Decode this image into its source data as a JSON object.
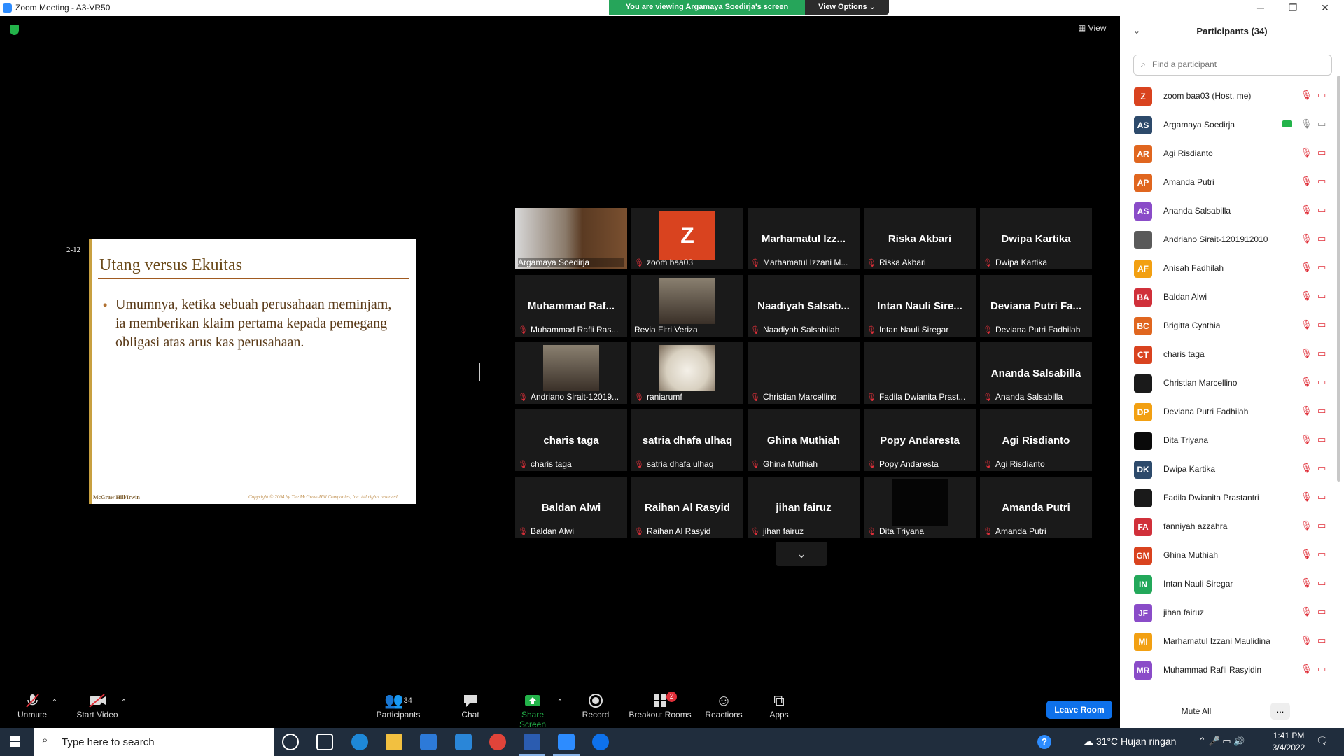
{
  "window": {
    "title": "Zoom Meeting - A3-VR50",
    "minimize": "─",
    "maximize": "❐",
    "close": "✕"
  },
  "banner": {
    "viewing": "You are viewing Argamaya Soedirja's screen",
    "view_options": "View Options ⌄"
  },
  "view_label": "View",
  "slide": {
    "number": "2-12",
    "title": "Utang versus Ekuitas",
    "bullet": "Umumnya, ketika sebuah perusahaan meminjam, ia memberikan klaim pertama kepada pemegang obligasi atas arus kas perusahaan.",
    "footer_left": "McGraw Hill/Irwin",
    "footer_right": "Copyright © 2004 by The McGraw-Hill Companies, Inc.  All rights reserved."
  },
  "tiles": [
    {
      "big": "",
      "name": "Argamaya Soedirja",
      "mic_off": false,
      "kind": "video",
      "active": true
    },
    {
      "big": "",
      "name": "zoom baa03",
      "mic_off": true,
      "kind": "z-avatar"
    },
    {
      "big": "Marhamatul  Izz...",
      "name": "Marhamatul Izzani M...",
      "mic_off": true,
      "kind": "name"
    },
    {
      "big": "Riska Akbari",
      "name": "Riska Akbari",
      "mic_off": true,
      "kind": "name"
    },
    {
      "big": "Dwipa Kartika",
      "name": "Dwipa Kartika",
      "mic_off": true,
      "kind": "name"
    },
    {
      "big": "Muhammad  Raf...",
      "name": "Muhammad Rafli Ras...",
      "mic_off": true,
      "kind": "name"
    },
    {
      "big": "",
      "name": "Revia Fitri Veriza",
      "mic_off": false,
      "kind": "photo"
    },
    {
      "big": "Naadiyah  Salsab...",
      "name": "Naadiyah Salsabilah",
      "mic_off": true,
      "kind": "name"
    },
    {
      "big": "Intan Nauli Sire...",
      "name": "Intan Nauli Siregar",
      "mic_off": true,
      "kind": "name"
    },
    {
      "big": "Deviana Putri Fa...",
      "name": "Deviana Putri Fadhilah",
      "mic_off": true,
      "kind": "name"
    },
    {
      "big": "",
      "name": "Andriano Sirait-12019...",
      "mic_off": true,
      "kind": "photo"
    },
    {
      "big": "",
      "name": "raniarumf",
      "mic_off": true,
      "kind": "cat"
    },
    {
      "big": "",
      "name": "Christian Marcellino",
      "mic_off": true,
      "kind": "blank"
    },
    {
      "big": "",
      "name": "Fadila Dwianita Prast...",
      "mic_off": true,
      "kind": "blank"
    },
    {
      "big": "Ananda Salsabilla",
      "name": "Ananda Salsabilla",
      "mic_off": true,
      "kind": "name"
    },
    {
      "big": "charis taga",
      "name": "charis taga",
      "mic_off": true,
      "kind": "name"
    },
    {
      "big": "satria dhafa ulhaq",
      "name": "satria dhafa ulhaq",
      "mic_off": true,
      "kind": "name"
    },
    {
      "big": "Ghina Muthiah",
      "name": "Ghina Muthiah",
      "mic_off": true,
      "kind": "name"
    },
    {
      "big": "Popy Andaresta",
      "name": "Popy Andaresta",
      "mic_off": true,
      "kind": "name"
    },
    {
      "big": "Agi Risdianto",
      "name": "Agi Risdianto",
      "mic_off": true,
      "kind": "name"
    },
    {
      "big": "Baldan Alwi",
      "name": "Baldan Alwi",
      "mic_off": true,
      "kind": "name"
    },
    {
      "big": "Raihan Al Rasyid",
      "name": "Raihan Al Rasyid",
      "mic_off": true,
      "kind": "name"
    },
    {
      "big": "jihan fairuz",
      "name": "jihan fairuz",
      "mic_off": true,
      "kind": "name"
    },
    {
      "big": "",
      "name": "Dita Triyana",
      "mic_off": true,
      "kind": "black"
    },
    {
      "big": "Amanda Putri",
      "name": "Amanda Putri",
      "mic_off": true,
      "kind": "name"
    }
  ],
  "toolbar": {
    "unmute": "Unmute",
    "start_video": "Start Video",
    "participants": "Participants",
    "participants_count": "34",
    "chat": "Chat",
    "share_screen": "Share Screen",
    "record": "Record",
    "breakout_rooms": "Breakout Rooms",
    "breakout_badge": "2",
    "reactions": "Reactions",
    "apps": "Apps",
    "leave_room": "Leave Room"
  },
  "panel": {
    "title": "Participants (34)",
    "search_placeholder": "Find a participant",
    "mute_all": "Mute All",
    "more": "...",
    "participants": [
      {
        "initials": "Z",
        "name": "zoom baa03 (Host, me)",
        "color": "#d9431f"
      },
      {
        "initials": "AS",
        "name": "Argamaya Soedirja",
        "color": "#2d4a6b",
        "sharing": true
      },
      {
        "initials": "AR",
        "name": "Agi Risdianto",
        "color": "#e0661f"
      },
      {
        "initials": "AP",
        "name": "Amanda Putri",
        "color": "#e0661f"
      },
      {
        "initials": "AS",
        "name": "Ananda Salsabilla",
        "color": "#8a4cc8"
      },
      {
        "initials": "",
        "name": "Andriano Sirait-1201912010",
        "color": "#5a5a5a"
      },
      {
        "initials": "AF",
        "name": "Anisah Fadhilah",
        "color": "#f2a012"
      },
      {
        "initials": "BA",
        "name": "Baldan Alwi",
        "color": "#d0303a"
      },
      {
        "initials": "BC",
        "name": "Brigitta Cynthia",
        "color": "#e0661f"
      },
      {
        "initials": "CT",
        "name": "charis taga",
        "color": "#d9431f"
      },
      {
        "initials": "",
        "name": "Christian Marcellino",
        "color": "#1a1a1a"
      },
      {
        "initials": "DP",
        "name": "Deviana Putri Fadhilah",
        "color": "#f2a012"
      },
      {
        "initials": "",
        "name": "Dita Triyana",
        "color": "#0a0a0a"
      },
      {
        "initials": "DK",
        "name": "Dwipa Kartika",
        "color": "#2d4a6b"
      },
      {
        "initials": "",
        "name": "Fadila Dwianita Prastantri",
        "color": "#1a1a1a"
      },
      {
        "initials": "FA",
        "name": "fanniyah azzahra",
        "color": "#d0303a"
      },
      {
        "initials": "GM",
        "name": "Ghina Muthiah",
        "color": "#d9431f"
      },
      {
        "initials": "IN",
        "name": "Intan Nauli Siregar",
        "color": "#23a85a"
      },
      {
        "initials": "JF",
        "name": "jihan fairuz",
        "color": "#8a4cc8"
      },
      {
        "initials": "MI",
        "name": "Marhamatul Izzani Maulidina",
        "color": "#f2a012"
      },
      {
        "initials": "MR",
        "name": "Muhammad Rafli Rasyidin",
        "color": "#8a4cc8"
      }
    ]
  },
  "taskbar": {
    "search_placeholder": "Type here to search",
    "weather": "31°C  Hujan ringan",
    "time": "1:41 PM",
    "date": "3/4/2022",
    "help": "?"
  }
}
